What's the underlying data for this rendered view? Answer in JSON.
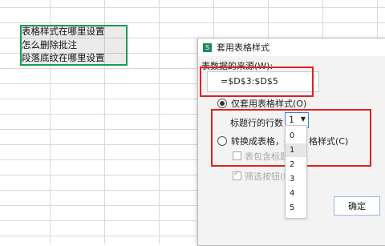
{
  "sheet": {
    "cells": [
      "表格样式在哪里设置",
      "怎么删除批注",
      "段落底纹在哪里设置"
    ]
  },
  "dialog": {
    "title": "套用表格样式",
    "app_icon": "S",
    "source_label": "表数据的来源(W):",
    "source_value": "=$D$3:$D$5",
    "option_style_only": "仅套用表格样式(O)",
    "rows_label": "标题行的行数",
    "rows_value": "1",
    "option_convert": "转换成表格，并",
    "option_convert_tail": "格样式(C)",
    "checkbox_header": "表包含标题",
    "checkbox_filter": "筛选按钮(F",
    "ok_label": "确定",
    "dropdown_options": [
      "0",
      "1",
      "2",
      "3",
      "4",
      "5"
    ],
    "dropdown_selected": "1"
  },
  "colors": {
    "selection_border": "#1a9b5a",
    "highlight_red": "#e02020"
  }
}
